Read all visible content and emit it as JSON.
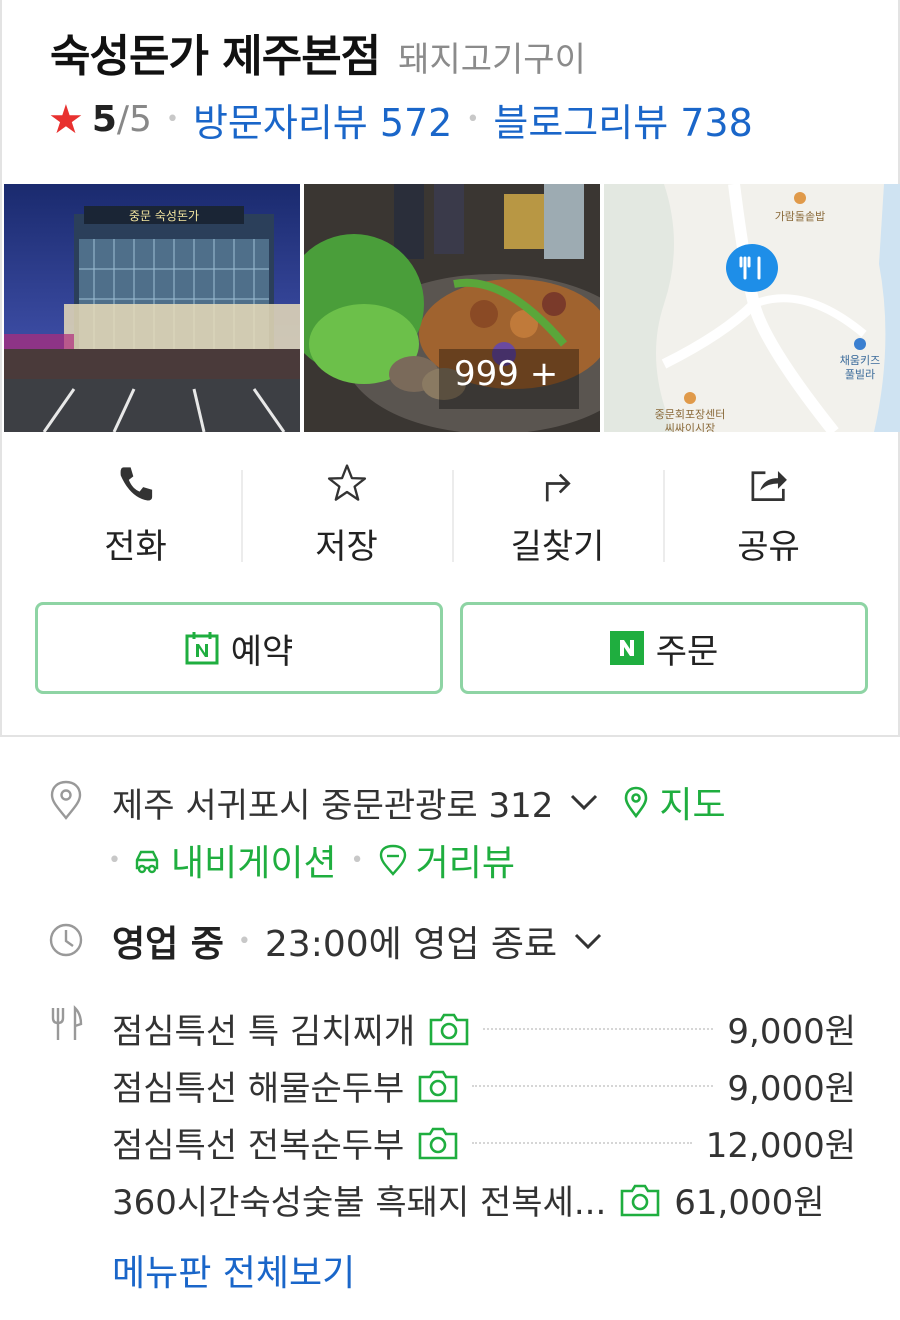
{
  "place": {
    "name": "숙성돈가 제주본점",
    "category": "돼지고기구이",
    "rating_value": "5",
    "rating_max": "/5",
    "visitor_reviews": "방문자리뷰 572",
    "blog_reviews": "블로그리뷰 738"
  },
  "photos": {
    "count_label": "999 +",
    "sign_text": "중문 숙성돈가"
  },
  "map": {
    "poi_top": "가람돌솥밥",
    "poi_right_1": "채움키즈",
    "poi_right_2": "풀빌라",
    "poi_bottom": "중문회포장센터",
    "poi_bottom_2": "씨싸이시장"
  },
  "actions": [
    {
      "label": "전화",
      "icon": "phone-icon"
    },
    {
      "label": "저장",
      "icon": "star-outline-icon"
    },
    {
      "label": "길찾기",
      "icon": "directions-icon"
    },
    {
      "label": "공유",
      "icon": "share-icon"
    }
  ],
  "buttons": {
    "reserve": "예약",
    "order": "주문"
  },
  "address": {
    "text": "제주 서귀포시 중문관광로 312",
    "map_link": "지도",
    "navigation": "내비게이션",
    "street_view": "거리뷰"
  },
  "hours": {
    "status": "영업 중",
    "detail": "23:00에 영업 종료"
  },
  "menu": {
    "items": [
      {
        "name": "점심특선 특 김치찌개",
        "price": "9,000원"
      },
      {
        "name": "점심특선 해물순두부",
        "price": "9,000원"
      },
      {
        "name": "점심특선 전복순두부",
        "price": "12,000원"
      },
      {
        "name": "360시간숙성숯불 흑돼지 전복세...",
        "price": "61,000원"
      }
    ],
    "view_all": "메뉴판 전체보기"
  },
  "colors": {
    "green": "#1fae3f",
    "blue_link": "#1a66c9",
    "star": "#e8312f",
    "button_border": "#8ed4a4"
  }
}
